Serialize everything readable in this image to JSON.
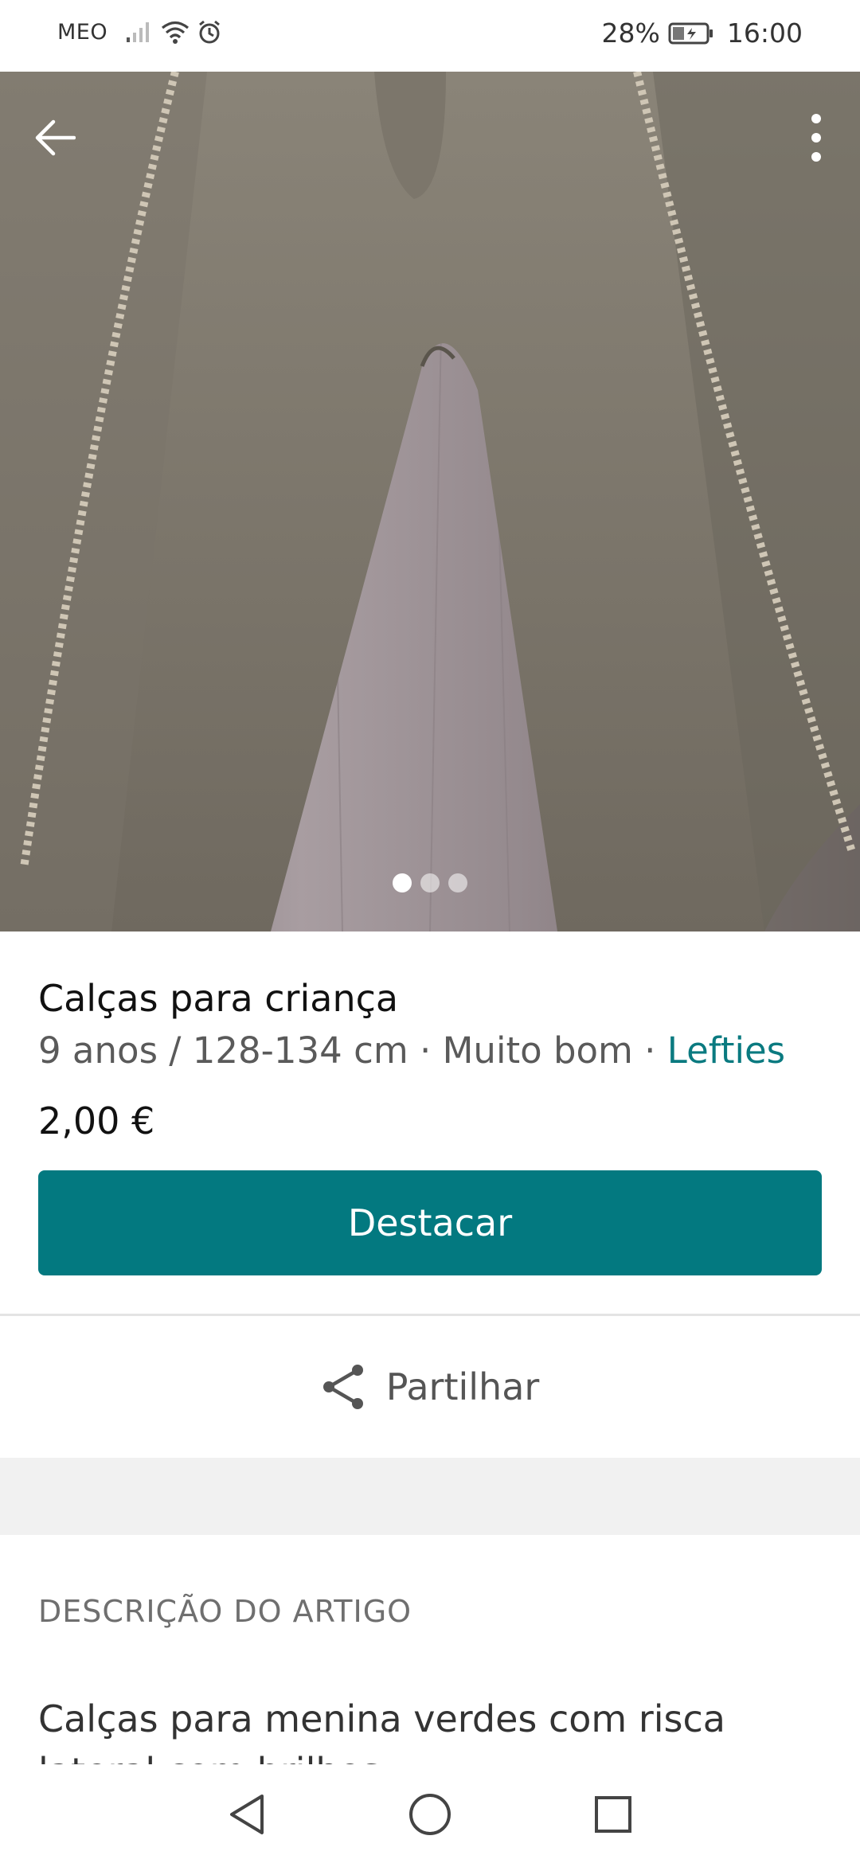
{
  "status_bar": {
    "carrier": "MEO",
    "battery_percent": "28%",
    "time": "16:00"
  },
  "gallery": {
    "photo_count": 3,
    "active_index": 0
  },
  "item": {
    "title": "Calças para criança",
    "size": "9 anos / 128-134 cm",
    "condition": "Muito bom",
    "separator": " · ",
    "brand": "Lefties",
    "price": "2,00 €"
  },
  "actions": {
    "promote_label": "Destacar",
    "share_label": "Partilhar"
  },
  "description": {
    "section_title": "DESCRIÇÃO DO ARTIGO",
    "text": "Calças para menina verdes com risca lateral com brilhos"
  },
  "colors": {
    "accent": "#037980",
    "link": "#0a7a80"
  },
  "icons": {
    "back": "arrow-left-icon",
    "more": "more-vertical-icon",
    "share": "share-icon",
    "nav_back": "triangle-back-icon",
    "nav_home": "circle-home-icon",
    "nav_recents": "square-recents-icon"
  }
}
